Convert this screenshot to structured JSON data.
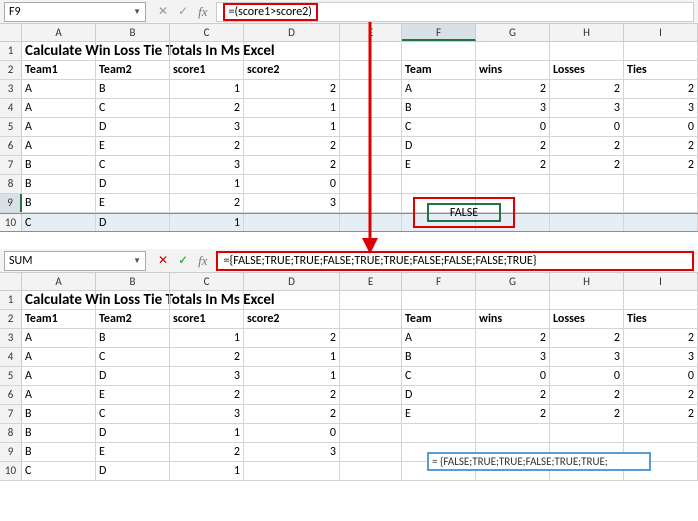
{
  "top": {
    "namebox": "F9",
    "formula": "=(score1>score2)",
    "columns": [
      "A",
      "B",
      "C",
      "D",
      "E",
      "F",
      "G",
      "H",
      "I"
    ],
    "row_numbers": [
      "1",
      "2",
      "3",
      "4",
      "5",
      "6",
      "7",
      "8",
      "9",
      "10"
    ],
    "title": "Calculate Win Loss Tie Totals In Ms Excel",
    "headers_left": {
      "a": "Team1",
      "b": "Team2",
      "c": "score1",
      "d": "score2"
    },
    "headers_right": {
      "f": "Team",
      "g": "wins",
      "h": "Losses",
      "i": "Ties"
    },
    "data": [
      {
        "a": "A",
        "b": "B",
        "c": "1",
        "d": "2",
        "f": "A",
        "g": "2",
        "h": "2",
        "i": "2"
      },
      {
        "a": "A",
        "b": "C",
        "c": "2",
        "d": "1",
        "f": "B",
        "g": "3",
        "h": "3",
        "i": "3"
      },
      {
        "a": "A",
        "b": "D",
        "c": "3",
        "d": "1",
        "f": "C",
        "g": "0",
        "h": "0",
        "i": "0"
      },
      {
        "a": "A",
        "b": "E",
        "c": "2",
        "d": "2",
        "f": "D",
        "g": "2",
        "h": "2",
        "i": "2"
      },
      {
        "a": "B",
        "b": "C",
        "c": "3",
        "d": "2",
        "f": "E",
        "g": "2",
        "h": "2",
        "i": "2"
      },
      {
        "a": "B",
        "b": "D",
        "c": "1",
        "d": "0",
        "f": "",
        "g": "",
        "h": "",
        "i": ""
      },
      {
        "a": "B",
        "b": "E",
        "c": "2",
        "d": "3",
        "f": "",
        "g": "",
        "h": "",
        "i": ""
      },
      {
        "a": "C",
        "b": "D",
        "c": "1",
        "d": "",
        "f": "",
        "g": "",
        "h": "",
        "i": ""
      }
    ],
    "selected_value": "FALSE"
  },
  "bottom": {
    "namebox": "SUM",
    "formula": "={FALSE;TRUE;TRUE;FALSE;TRUE;TRUE;FALSE;FALSE;FALSE;TRUE}",
    "columns": [
      "A",
      "B",
      "C",
      "D",
      "E",
      "F",
      "G",
      "H",
      "I"
    ],
    "row_numbers": [
      "1",
      "2",
      "3",
      "4",
      "5",
      "6",
      "7",
      "8",
      "9",
      "10"
    ],
    "title": "Calculate Win Loss Tie Totals In Ms Excel",
    "headers_left": {
      "a": "Team1",
      "b": "Team2",
      "c": "score1",
      "d": "score2"
    },
    "headers_right": {
      "f": "Team",
      "g": "wins",
      "h": "Losses",
      "i": "Ties"
    },
    "data": [
      {
        "a": "A",
        "b": "B",
        "c": "1",
        "d": "2",
        "f": "A",
        "g": "2",
        "h": "2",
        "i": "2"
      },
      {
        "a": "A",
        "b": "C",
        "c": "2",
        "d": "1",
        "f": "B",
        "g": "3",
        "h": "3",
        "i": "3"
      },
      {
        "a": "A",
        "b": "D",
        "c": "3",
        "d": "1",
        "f": "C",
        "g": "0",
        "h": "0",
        "i": "0"
      },
      {
        "a": "A",
        "b": "E",
        "c": "2",
        "d": "2",
        "f": "D",
        "g": "2",
        "h": "2",
        "i": "2"
      },
      {
        "a": "B",
        "b": "C",
        "c": "3",
        "d": "2",
        "f": "E",
        "g": "2",
        "h": "2",
        "i": "2"
      },
      {
        "a": "B",
        "b": "D",
        "c": "1",
        "d": "0",
        "f": "",
        "g": "",
        "h": "",
        "i": ""
      },
      {
        "a": "B",
        "b": "E",
        "c": "2",
        "d": "3",
        "f": "",
        "g": "",
        "h": "",
        "i": ""
      },
      {
        "a": "C",
        "b": "D",
        "c": "1",
        "d": "",
        "f": "",
        "g": "",
        "h": "",
        "i": ""
      }
    ],
    "editing_value": "= {FALSE;TRUE;TRUE;FALSE;TRUE;TRUE;"
  },
  "icons": {
    "cancel": "✕",
    "enter": "✓",
    "fx": "fx",
    "dropdown": "▼"
  }
}
